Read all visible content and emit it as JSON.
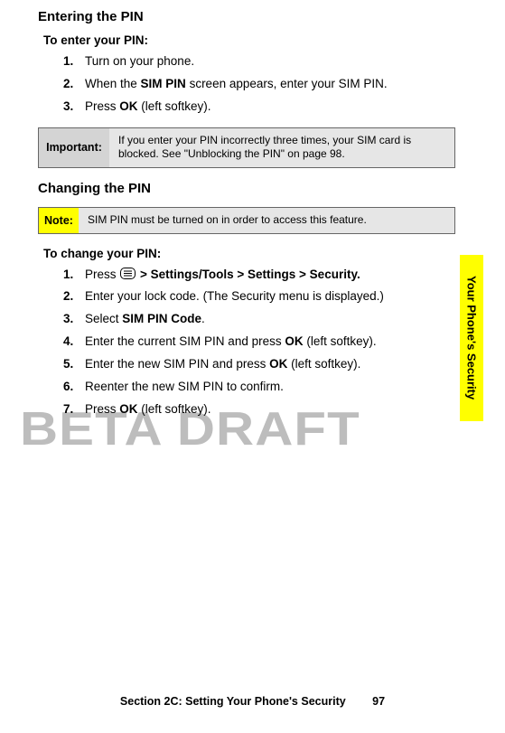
{
  "h1a": "Entering the PIN",
  "leadA": "To enter your PIN:",
  "stepsA": {
    "n1": "1.",
    "t1a": "Turn on your phone.",
    "n2": "2.",
    "t2a": "When the ",
    "t2b": "SIM PIN",
    "t2c": " screen appears, enter your SIM PIN.",
    "n3": "3.",
    "t3a": "Press ",
    "t3b": "OK",
    "t3c": " (left softkey)."
  },
  "important": {
    "label": "Important:",
    "body": "If you enter your PIN incorrectly three times, your SIM card is blocked. See \"Unblocking the PIN\" on page 98."
  },
  "h1b": "Changing the PIN",
  "note": {
    "label": "Note:",
    "body": "SIM PIN must be turned on in order to access this feature."
  },
  "leadB": "To change your PIN:",
  "stepsB": {
    "n1": "1.",
    "t1a": "Press ",
    "t1b": " > Settings/Tools > Settings > Security.",
    "n2": "2.",
    "t2a": "Enter your lock code. (The Security menu is displayed.)",
    "n3": "3.",
    "t3a": "Select ",
    "t3b": "SIM PIN Code",
    "t3c": ".",
    "n4": "4.",
    "t4a": "Enter the current SIM PIN and press ",
    "t4b": "OK",
    "t4c": " (left softkey).",
    "n5": "5.",
    "t5a": "Enter the new SIM PIN and press ",
    "t5b": "OK",
    "t5c": " (left softkey).",
    "n6": "6.",
    "t6a": "Reenter the new SIM PIN to confirm.",
    "n7": "7.",
    "t7a": "Press ",
    "t7b": "OK",
    "t7c": " (left softkey)."
  },
  "sideTab": "Your Phone's Security",
  "watermark": "BETA DRAFT",
  "footer": {
    "section": "Section 2C: Setting Your Phone's Security",
    "page": "97"
  }
}
